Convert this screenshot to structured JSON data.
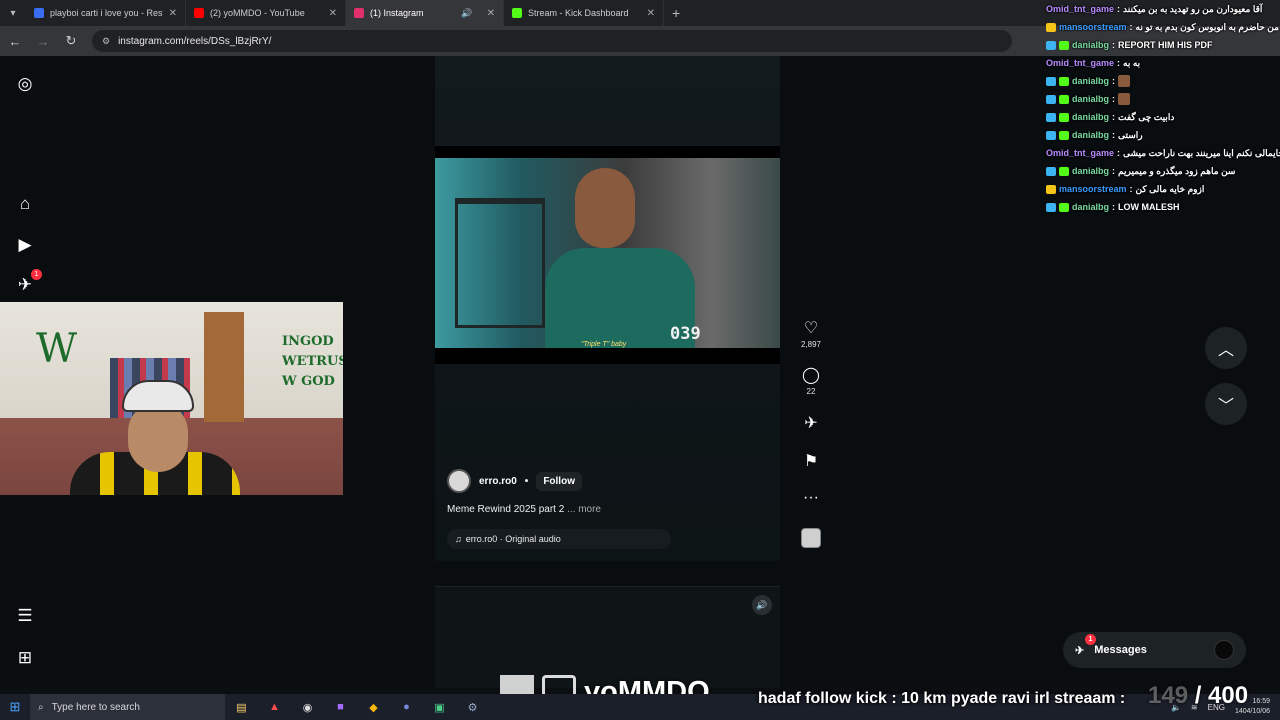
{
  "browser": {
    "tabs": [
      {
        "title": "playboi carti i love you - Restre",
        "active": false,
        "fav_color": "#3a6df0"
      },
      {
        "title": "(2) yoMMDO - YouTube",
        "active": false,
        "fav_color": "#ff0000"
      },
      {
        "title": "(1) Instagram",
        "active": true,
        "fav_color": "#e1306c"
      },
      {
        "title": "Stream - Kick Dashboard",
        "active": false,
        "fav_color": "#53fc18"
      }
    ],
    "new_tab": "+",
    "url": "instagram.com/reels/DSs_lBzjRrY/"
  },
  "reel": {
    "subtitle": "\"Triple T\" baby",
    "jersey_number": "039",
    "author": "erro.ro0",
    "separator": "•",
    "follow_label": "Follow",
    "caption": "Meme Rewind 2025 part 2",
    "caption_more": "... more",
    "audio": "erro.ro0 · Original audio"
  },
  "actions": {
    "likes": "2,897",
    "comments": "22"
  },
  "sidebar": {
    "notification_count": "1"
  },
  "messages": {
    "label": "Messages",
    "badge": "1"
  },
  "chat": [
    {
      "user": "Omid_tnt_game",
      "color": "#b98cff",
      "badge": "none",
      "text": "آقا معیودارن من رو تهدید به بن میکنند"
    },
    {
      "user": "mansoorstream",
      "color": "#3a9bff",
      "badge": "crown",
      "text": "من حاضرم به انوبوس کون بدم به تو نه"
    },
    {
      "user": "danialbg",
      "color": "#7ad9a0",
      "badge": "mod",
      "text": "REPORT HIM HIS PDF"
    },
    {
      "user": "Omid_tnt_game",
      "color": "#b98cff",
      "badge": "none",
      "text": "به به"
    },
    {
      "user": "danialbg",
      "color": "#7ad9a0",
      "badge": "mod",
      "text": "",
      "emote": true
    },
    {
      "user": "danialbg",
      "color": "#7ad9a0",
      "badge": "mod",
      "text": "",
      "emote": true
    },
    {
      "user": "danialbg",
      "color": "#7ad9a0",
      "badge": "mod",
      "text": "دابیت چی گفت"
    },
    {
      "user": "danialbg",
      "color": "#7ad9a0",
      "badge": "mod",
      "text": "راستی"
    },
    {
      "user": "Omid_tnt_game",
      "color": "#b98cff",
      "badge": "none",
      "text": "خوب خایمالی نکنم اینا میرینند بهت ناراحت میشی"
    },
    {
      "user": "danialbg",
      "color": "#7ad9a0",
      "badge": "mod",
      "text": "سن ماهم زود میگذره و میمیریم"
    },
    {
      "user": "mansoorstream",
      "color": "#3a9bff",
      "badge": "crown",
      "text": "ازوم خایه مالی کن"
    },
    {
      "user": "danialbg",
      "color": "#7ad9a0",
      "badge": "mod",
      "text": "LOW MALESH"
    }
  ],
  "chat_separator": ":",
  "taskbar": {
    "search_placeholder": "Type here to search",
    "lang": "ENG",
    "time": "16:59",
    "date": "1404/10/06"
  },
  "overlay": {
    "brand": "yoMMDO",
    "ticker": "hadaf follow kick : 10 km pyade ravi irl streaam :",
    "goal_current": "149",
    "goal_total": "/ 400"
  },
  "colors": {
    "accent_red": "#ff3040",
    "page_bg": "#0a0d10"
  }
}
